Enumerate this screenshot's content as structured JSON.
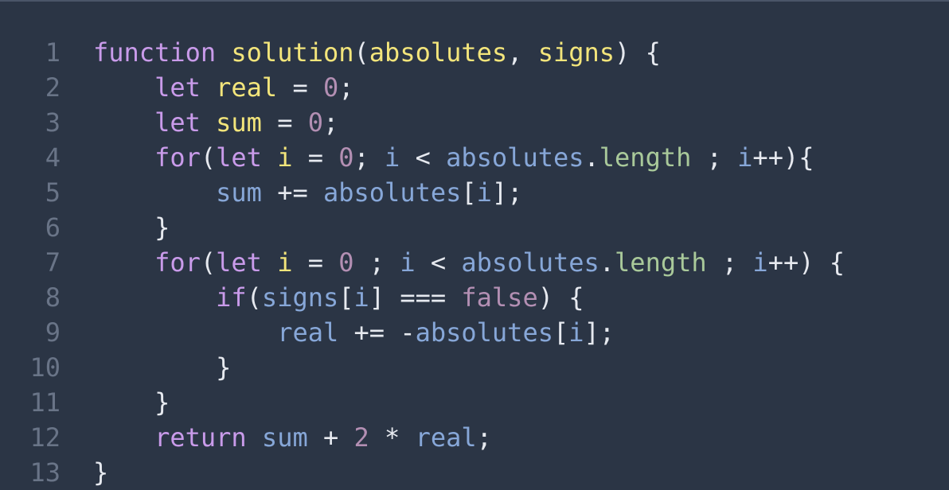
{
  "editor": {
    "language_colors": {
      "background": "#2b3545",
      "keyword": "#c99bea",
      "function_name": "#f3e57b",
      "identifier": "#87a7d8",
      "number": "#b38fb3",
      "property": "#a9c99a",
      "punctuation": "#e6e9ef",
      "line_number": "#697487"
    },
    "lines": [
      {
        "number": "1",
        "tokens": [
          {
            "text": "function",
            "type": "keyword"
          },
          {
            "text": " ",
            "type": "punc"
          },
          {
            "text": "solution",
            "type": "fn"
          },
          {
            "text": "(",
            "type": "punc"
          },
          {
            "text": "absolutes",
            "type": "param"
          },
          {
            "text": ", ",
            "type": "punc"
          },
          {
            "text": "signs",
            "type": "param"
          },
          {
            "text": ") {",
            "type": "punc"
          }
        ]
      },
      {
        "number": "2",
        "tokens": [
          {
            "text": "    ",
            "type": "punc"
          },
          {
            "text": "let",
            "type": "keyword"
          },
          {
            "text": " ",
            "type": "punc"
          },
          {
            "text": "real",
            "type": "var"
          },
          {
            "text": " = ",
            "type": "punc"
          },
          {
            "text": "0",
            "type": "num"
          },
          {
            "text": ";",
            "type": "punc"
          }
        ]
      },
      {
        "number": "3",
        "tokens": [
          {
            "text": "    ",
            "type": "punc"
          },
          {
            "text": "let",
            "type": "keyword"
          },
          {
            "text": " ",
            "type": "punc"
          },
          {
            "text": "sum",
            "type": "var"
          },
          {
            "text": " = ",
            "type": "punc"
          },
          {
            "text": "0",
            "type": "num"
          },
          {
            "text": ";",
            "type": "punc"
          }
        ]
      },
      {
        "number": "4",
        "tokens": [
          {
            "text": "    ",
            "type": "punc"
          },
          {
            "text": "for",
            "type": "keyword"
          },
          {
            "text": "(",
            "type": "punc"
          },
          {
            "text": "let",
            "type": "keyword"
          },
          {
            "text": " ",
            "type": "punc"
          },
          {
            "text": "i",
            "type": "var"
          },
          {
            "text": " = ",
            "type": "punc"
          },
          {
            "text": "0",
            "type": "num"
          },
          {
            "text": "; ",
            "type": "punc"
          },
          {
            "text": "i",
            "type": "ident"
          },
          {
            "text": " < ",
            "type": "punc"
          },
          {
            "text": "absolutes",
            "type": "ident"
          },
          {
            "text": ".",
            "type": "punc"
          },
          {
            "text": "length",
            "type": "prop"
          },
          {
            "text": " ; ",
            "type": "punc"
          },
          {
            "text": "i",
            "type": "ident"
          },
          {
            "text": "++){",
            "type": "punc"
          }
        ]
      },
      {
        "number": "5",
        "tokens": [
          {
            "text": "        ",
            "type": "punc"
          },
          {
            "text": "sum",
            "type": "ident"
          },
          {
            "text": " += ",
            "type": "punc"
          },
          {
            "text": "absolutes",
            "type": "ident"
          },
          {
            "text": "[",
            "type": "punc"
          },
          {
            "text": "i",
            "type": "ident"
          },
          {
            "text": "];",
            "type": "punc"
          }
        ]
      },
      {
        "number": "6",
        "tokens": [
          {
            "text": "    }",
            "type": "punc"
          }
        ]
      },
      {
        "number": "7",
        "tokens": [
          {
            "text": "    ",
            "type": "punc"
          },
          {
            "text": "for",
            "type": "keyword"
          },
          {
            "text": "(",
            "type": "punc"
          },
          {
            "text": "let",
            "type": "keyword"
          },
          {
            "text": " ",
            "type": "punc"
          },
          {
            "text": "i",
            "type": "var"
          },
          {
            "text": " = ",
            "type": "punc"
          },
          {
            "text": "0",
            "type": "num"
          },
          {
            "text": " ; ",
            "type": "punc"
          },
          {
            "text": "i",
            "type": "ident"
          },
          {
            "text": " < ",
            "type": "punc"
          },
          {
            "text": "absolutes",
            "type": "ident"
          },
          {
            "text": ".",
            "type": "punc"
          },
          {
            "text": "length",
            "type": "prop"
          },
          {
            "text": " ; ",
            "type": "punc"
          },
          {
            "text": "i",
            "type": "ident"
          },
          {
            "text": "++) {",
            "type": "punc"
          }
        ]
      },
      {
        "number": "8",
        "tokens": [
          {
            "text": "        ",
            "type": "punc"
          },
          {
            "text": "if",
            "type": "keyword"
          },
          {
            "text": "(",
            "type": "punc"
          },
          {
            "text": "signs",
            "type": "ident"
          },
          {
            "text": "[",
            "type": "punc"
          },
          {
            "text": "i",
            "type": "ident"
          },
          {
            "text": "] === ",
            "type": "punc"
          },
          {
            "text": "false",
            "type": "bool"
          },
          {
            "text": ") {",
            "type": "punc"
          }
        ]
      },
      {
        "number": "9",
        "tokens": [
          {
            "text": "            ",
            "type": "punc"
          },
          {
            "text": "real",
            "type": "ident"
          },
          {
            "text": " += -",
            "type": "punc"
          },
          {
            "text": "absolutes",
            "type": "ident"
          },
          {
            "text": "[",
            "type": "punc"
          },
          {
            "text": "i",
            "type": "ident"
          },
          {
            "text": "];",
            "type": "punc"
          }
        ]
      },
      {
        "number": "10",
        "tokens": [
          {
            "text": "        }",
            "type": "punc"
          }
        ]
      },
      {
        "number": "11",
        "tokens": [
          {
            "text": "    }",
            "type": "punc"
          }
        ]
      },
      {
        "number": "12",
        "tokens": [
          {
            "text": "    ",
            "type": "punc"
          },
          {
            "text": "return",
            "type": "keyword"
          },
          {
            "text": " ",
            "type": "punc"
          },
          {
            "text": "sum",
            "type": "ident"
          },
          {
            "text": " + ",
            "type": "punc"
          },
          {
            "text": "2",
            "type": "num"
          },
          {
            "text": " * ",
            "type": "punc"
          },
          {
            "text": "real",
            "type": "ident"
          },
          {
            "text": ";",
            "type": "punc"
          }
        ]
      },
      {
        "number": "13",
        "tokens": [
          {
            "text": "}",
            "type": "punc"
          }
        ]
      }
    ]
  }
}
